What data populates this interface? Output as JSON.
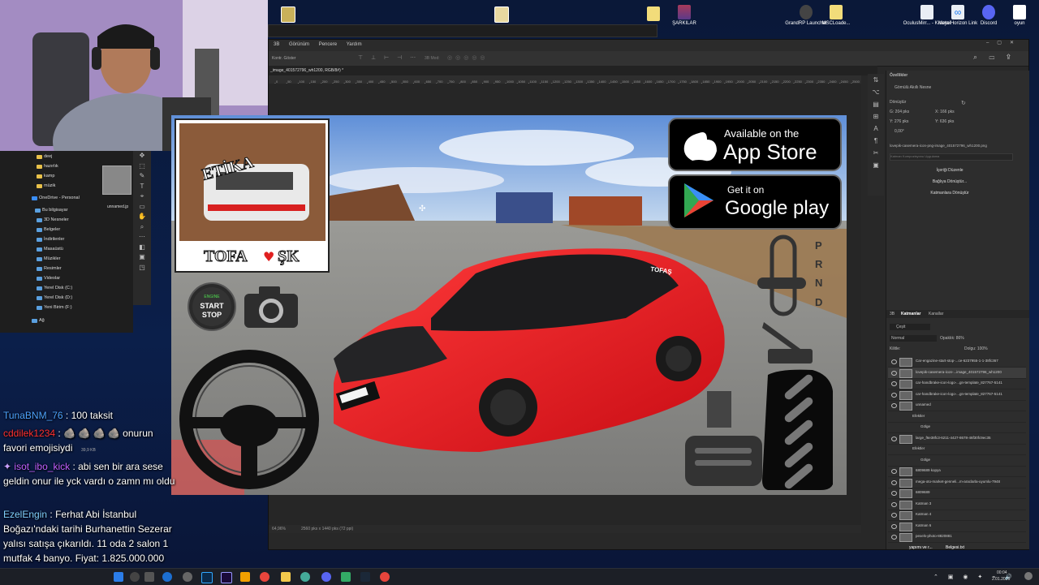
{
  "desktop": {
    "icons": [
      {
        "label": "",
        "icon": "image-file-icon"
      },
      {
        "label": "",
        "icon": "image-file-icon"
      },
      {
        "label": "",
        "icon": "folder-icon"
      },
      {
        "label": "ŞARKILAR",
        "icon": "winrar-icon"
      },
      {
        "label": "GrandRP Launcher",
        "icon": "grandrp-icon"
      },
      {
        "label": "MSCLoade...",
        "icon": "folder-icon"
      },
      {
        "label": "OculusMirr... - Kısayol",
        "icon": "oculus-icon"
      },
      {
        "label": "Meta Horizon Link",
        "icon": "meta-icon"
      },
      {
        "label": "Discord",
        "icon": "discord-icon"
      },
      {
        "label": "oyun",
        "icon": "text-file-icon"
      }
    ],
    "bottom_labels": [
      "yapımı ve r...",
      "Belgesi.txt"
    ]
  },
  "photoshop": {
    "menu": [
      "3B",
      "Görünüm",
      "Pencere",
      "Yardım"
    ],
    "options": {
      "kontrol": "Kontr. Göster",
      "mode": "3B Mod:"
    },
    "tab": "_image_401572796_wh1200, RGB/8#) *",
    "status": {
      "zoom": "64,96%",
      "size": "2560 pks x 1440 pks (72 ppi)"
    },
    "ruler_marks": [
      "0",
      "50",
      "100",
      "150",
      "200",
      "250",
      "300",
      "350",
      "400",
      "450",
      "500",
      "550",
      "600",
      "650",
      "700",
      "750",
      "800",
      "850",
      "900",
      "950",
      "1000",
      "1050",
      "1100",
      "1150",
      "1200",
      "1250",
      "1300",
      "1350",
      "1400",
      "1450",
      "1500",
      "1550",
      "1600",
      "1650",
      "1700",
      "1750",
      "1800",
      "1850",
      "1900",
      "1950",
      "2000",
      "2050",
      "2100",
      "2150",
      "2200",
      "2250",
      "2300",
      "2350",
      "2400",
      "2450",
      "2500"
    ],
    "properties": {
      "title": "Özellikler",
      "object": "Gömülü Akıllı Nesne",
      "transform_label": "Dönüştür",
      "w": "G: 204 pks",
      "x": "X: 166 pks",
      "h": "Y: 276 pks",
      "y": "Y: 636 pks",
      "angle": "0,00°",
      "file": "lovepik-casemera-icon-png-image_401572796_wh1200.png",
      "comps": "Katman Kompozisyonu Uygulama",
      "buttons": [
        "İçeriği Düzenle",
        "Bağlıya Dönüştür...",
        "Katmanlara Dönüştür"
      ]
    },
    "layers_panel": {
      "tabs": [
        "3B",
        "Katmanlar",
        "Kanallar"
      ],
      "filter": "Çeşit",
      "blend": "Normal",
      "opacity": "Opaklık: 86%",
      "lock": "Kilitle:",
      "fill": "Dolgu: 100%",
      "layers": [
        "Car-engazine-start-stop-...ce-6237955-1-1-38fc367",
        "lovepik-casemera-icon-...image_401572796_wh1200",
        "car-handbrake-icon-logo-...gn-template_827767-5141",
        "car-handbrake-icon-logo-...gn-template_827767-5141",
        "unnamed",
        "Efektler",
        "Gölge",
        "large_f6e38fc3-6211-4427-8678-46f30fc9ec35",
        "Efektler",
        "Gölge",
        "6809689 kopya",
        "mega-oto-market-genneli...m-araclarla-uyumlu-7948",
        "6809689",
        "Katman 3",
        "Katman 4",
        "Katman 6",
        "pexels-photo-8820881"
      ]
    }
  },
  "explorer": {
    "items": [
      {
        "label": "deej",
        "icon": "folder-icon"
      },
      {
        "label": "hazırlık",
        "icon": "folder-icon"
      },
      {
        "label": "kamp",
        "icon": "folder-icon"
      },
      {
        "label": "müzik",
        "icon": "folder-icon"
      },
      {
        "label": "OneDrive - Personal",
        "icon": "onedrive-icon"
      },
      {
        "label": "Bu bilgisayar",
        "icon": "computer-icon"
      },
      {
        "label": "3D Nesneler",
        "icon": "cube-icon"
      },
      {
        "label": "Belgeler",
        "icon": "documents-icon"
      },
      {
        "label": "İndirilenler",
        "icon": "download-icon"
      },
      {
        "label": "Masaüstü",
        "icon": "desktop-icon"
      },
      {
        "label": "Müzikler",
        "icon": "music-icon"
      },
      {
        "label": "Resimler",
        "icon": "pictures-icon"
      },
      {
        "label": "Videolar",
        "icon": "video-icon"
      },
      {
        "label": "Yerel Disk (C:)",
        "icon": "drive-icon"
      },
      {
        "label": "Yerel Disk (D:)",
        "icon": "drive-icon"
      },
      {
        "label": "Yeni Birim (F:)",
        "icon": "drive-icon"
      },
      {
        "label": "Ağ",
        "icon": "network-icon"
      }
    ],
    "thumb_label": "unnamed.jp",
    "size_text": "39,9 KB"
  },
  "game": {
    "appstore_small": "Available on the",
    "appstore_big": "App Store",
    "gplay_small": "Get it on",
    "gplay_big": "Google play",
    "logo_top": "ETİKA",
    "logo_bottom_left": "TOFA",
    "logo_bottom_right": "ŞK",
    "engine_small": "ENGINE",
    "engine_big1": "START",
    "engine_big2": "STOP",
    "gears": [
      "P",
      "R",
      "N",
      "D"
    ],
    "windshield": "TOFAŞ"
  },
  "chat": {
    "messages": [
      {
        "user": "TunaBNM_76",
        "color": "#4da3ff",
        "text": "100 taksit"
      },
      {
        "user": "cddilek1234",
        "color": "#ff3030",
        "text": "🪨 🪨 🪨 🪨 onurun favori emojisiydi"
      },
      {
        "user": "isot_ibo_kick",
        "color": "#c060ff",
        "text": "abi sen bir ara sese geldin onur ile yck vardı o zamn mı oldu"
      },
      {
        "user": "EzelEngin",
        "color": "#80d0ff",
        "text": "Ferhat Abi İstanbul Boğazı'ndaki tarihi Burhanettin Sezerar yalısı satışa çıkarıldı. 11 oda 2 salon 1 mutfak 4 banyo. Fiyat: 1.825.000.000 TL"
      }
    ]
  },
  "taskbar": {
    "time": "00:04",
    "date": "2.01.2026"
  },
  "colors": {
    "car": "#e4141c",
    "ps_bg": "#282828",
    "desktop": "#0b1a3a"
  }
}
